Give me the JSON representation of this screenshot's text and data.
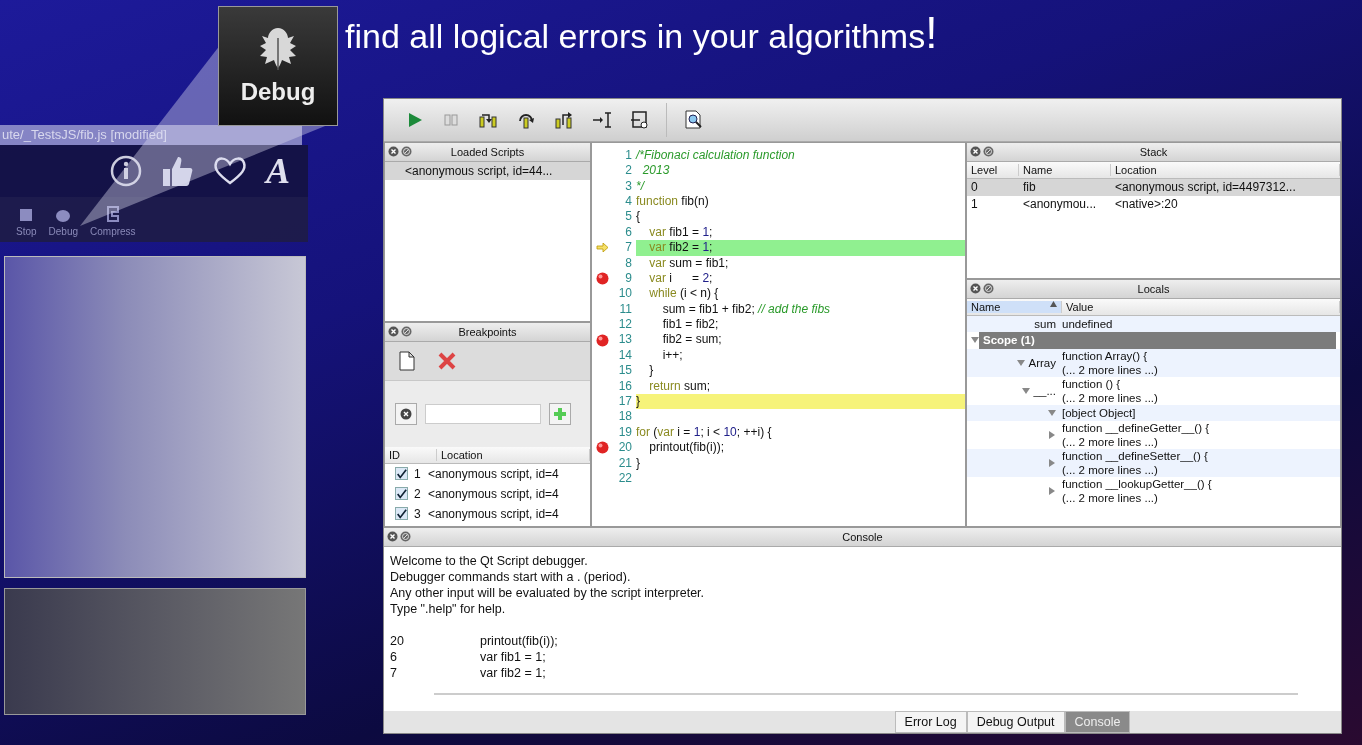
{
  "headline": {
    "text": "find all logical errors in your algorithms",
    "end": "!"
  },
  "callout": {
    "label": "Debug"
  },
  "background_app": {
    "title": "ute/_TestsJS/fib.js [modified]",
    "font_button": "A",
    "toolbar": [
      "Stop",
      "Debug",
      "Compress"
    ]
  },
  "loaded_scripts": {
    "title": "Loaded Scripts",
    "items": [
      {
        "text": "<anonymous script, id=44...",
        "selected": true
      }
    ]
  },
  "breakpoints": {
    "title": "Breakpoints",
    "columns": [
      "ID",
      "Location"
    ],
    "rows": [
      {
        "checked": true,
        "id": "1",
        "location": "<anonymous script, id=4"
      },
      {
        "checked": true,
        "id": "2",
        "location": "<anonymous script, id=4"
      },
      {
        "checked": true,
        "id": "3",
        "location": "<anonymous script, id=4"
      }
    ]
  },
  "code": {
    "lines": [
      {
        "number": "1",
        "breakpoint": false,
        "current": false,
        "highlighted": false,
        "tokens": [
          {
            "kind": "comment",
            "text": "/*Fibonaci calculation function"
          }
        ]
      },
      {
        "number": "2",
        "breakpoint": false,
        "current": false,
        "highlighted": false,
        "tokens": [
          {
            "kind": "comment",
            "text": "  2013"
          }
        ]
      },
      {
        "number": "3",
        "breakpoint": false,
        "current": false,
        "highlighted": false,
        "tokens": [
          {
            "kind": "comment",
            "text": "*/"
          }
        ]
      },
      {
        "number": "4",
        "breakpoint": false,
        "current": false,
        "highlighted": false,
        "tokens": [
          {
            "kind": "keyword",
            "text": "function"
          },
          {
            "kind": "plain",
            "text": " fib(n)"
          }
        ]
      },
      {
        "number": "5",
        "breakpoint": false,
        "current": false,
        "highlighted": false,
        "tokens": [
          {
            "kind": "plain",
            "text": "{"
          }
        ]
      },
      {
        "number": "6",
        "breakpoint": false,
        "current": false,
        "highlighted": false,
        "tokens": [
          {
            "kind": "keyword",
            "text": "    var"
          },
          {
            "kind": "plain",
            "text": " fib1 = "
          },
          {
            "kind": "number",
            "text": "1"
          },
          {
            "kind": "plain",
            "text": ";"
          }
        ]
      },
      {
        "number": "7",
        "breakpoint": false,
        "current": true,
        "highlighted": false,
        "tokens": [
          {
            "kind": "keyword",
            "text": "    var"
          },
          {
            "kind": "plain",
            "text": " fib2 = "
          },
          {
            "kind": "number",
            "text": "1"
          },
          {
            "kind": "plain",
            "text": ";"
          }
        ]
      },
      {
        "number": "8",
        "breakpoint": false,
        "current": false,
        "highlighted": false,
        "tokens": [
          {
            "kind": "keyword",
            "text": "    var"
          },
          {
            "kind": "plain",
            "text": " sum = fib1;"
          }
        ]
      },
      {
        "number": "9",
        "breakpoint": true,
        "current": false,
        "highlighted": false,
        "tokens": [
          {
            "kind": "keyword",
            "text": "    var"
          },
          {
            "kind": "plain",
            "text": " i      = "
          },
          {
            "kind": "number",
            "text": "2"
          },
          {
            "kind": "plain",
            "text": ";"
          }
        ]
      },
      {
        "number": "10",
        "breakpoint": false,
        "current": false,
        "highlighted": false,
        "tokens": [
          {
            "kind": "keyword",
            "text": "    while"
          },
          {
            "kind": "plain",
            "text": " (i < n) {"
          }
        ]
      },
      {
        "number": "11",
        "breakpoint": false,
        "current": false,
        "highlighted": false,
        "tokens": [
          {
            "kind": "plain",
            "text": "        sum = fib1 + fib2; "
          },
          {
            "kind": "comment",
            "text": "// add the fibs"
          }
        ]
      },
      {
        "number": "12",
        "breakpoint": false,
        "current": false,
        "highlighted": false,
        "tokens": [
          {
            "kind": "plain",
            "text": "        fib1 = fib2;"
          }
        ]
      },
      {
        "number": "13",
        "breakpoint": true,
        "current": false,
        "highlighted": false,
        "tokens": [
          {
            "kind": "plain",
            "text": "        fib2 = sum;"
          }
        ]
      },
      {
        "number": "14",
        "breakpoint": false,
        "current": false,
        "highlighted": false,
        "tokens": [
          {
            "kind": "plain",
            "text": "        i++;"
          }
        ]
      },
      {
        "number": "15",
        "breakpoint": false,
        "current": false,
        "highlighted": false,
        "tokens": [
          {
            "kind": "plain",
            "text": "    }"
          }
        ]
      },
      {
        "number": "16",
        "breakpoint": false,
        "current": false,
        "highlighted": false,
        "tokens": [
          {
            "kind": "keyword",
            "text": "    return"
          },
          {
            "kind": "plain",
            "text": " sum;"
          }
        ]
      },
      {
        "number": "17",
        "breakpoint": false,
        "current": false,
        "highlighted": true,
        "tokens": [
          {
            "kind": "plain",
            "text": "}"
          }
        ]
      },
      {
        "number": "18",
        "breakpoint": false,
        "current": false,
        "highlighted": false
      },
      {
        "number": "19",
        "breakpoint": false,
        "current": false,
        "highlighted": false,
        "tokens": [
          {
            "kind": "keyword",
            "text": "for"
          },
          {
            "kind": "plain",
            "text": " ("
          },
          {
            "kind": "keyword",
            "text": "var"
          },
          {
            "kind": "plain",
            "text": " i = "
          },
          {
            "kind": "number",
            "text": "1"
          },
          {
            "kind": "plain",
            "text": "; i < "
          },
          {
            "kind": "number",
            "text": "10"
          },
          {
            "kind": "plain",
            "text": "; ++i) {"
          }
        ]
      },
      {
        "number": "20",
        "breakpoint": true,
        "current": false,
        "highlighted": false,
        "tokens": [
          {
            "kind": "plain",
            "text": "    printout(fib(i));"
          }
        ]
      },
      {
        "number": "21",
        "breakpoint": false,
        "current": false,
        "highlighted": false,
        "tokens": [
          {
            "kind": "plain",
            "text": "}"
          }
        ]
      },
      {
        "number": "22",
        "breakpoint": false,
        "current": false,
        "highlighted": false
      }
    ]
  },
  "stack": {
    "title": "Stack",
    "columns": [
      "Level",
      "Name",
      "Location"
    ],
    "rows": [
      {
        "level": "0",
        "name": "fib",
        "location": "<anonymous script, id=4497312...",
        "selected": true
      },
      {
        "level": "1",
        "name": "<anonymou...",
        "location": "<native>:20",
        "selected": false
      }
    ]
  },
  "locals": {
    "title": "Locals",
    "columns": [
      "Name",
      "Value"
    ],
    "rows": [
      {
        "kind": "variable",
        "name": "sum",
        "value_lines": [
          "undefined"
        ]
      },
      {
        "kind": "group",
        "name": "Scope (1)",
        "expanded": true,
        "children": [
          {
            "kind": "variable",
            "name": "Array",
            "expanded": true,
            "value_lines": [
              "function Array() {",
              "(... 2 more lines ...)"
            ],
            "children": [
              {
                "kind": "variable",
                "name": "__...",
                "expanded": true,
                "value_lines": [
                  "function () {",
                  "(... 2 more lines ...)"
                ],
                "children": [
                  {
                    "kind": "variable",
                    "expanded": true,
                    "value_lines": [
                      "[object Object]"
                    ],
                    "children": [
                      {
                        "kind": "variable",
                        "expanded": false,
                        "value_lines": [
                          "function __defineGetter__() {",
                          "(... 2 more lines ...)"
                        ]
                      },
                      {
                        "kind": "variable",
                        "expanded": false,
                        "value_lines": [
                          "function __defineSetter__() {",
                          "(... 2 more lines ...)"
                        ]
                      },
                      {
                        "kind": "variable",
                        "expanded": false,
                        "value_lines": [
                          "function __lookupGetter__() {",
                          "(... 2 more lines ...)"
                        ]
                      }
                    ]
                  }
                ]
              }
            ]
          }
        ]
      }
    ]
  },
  "console": {
    "title": "Console",
    "messages": [
      "Welcome to the Qt Script debugger.",
      "Debugger commands start with a . (period).",
      "Any other input will be evaluated by the script interpreter.",
      "Type \".help\" for help."
    ],
    "trace": [
      {
        "line": "20",
        "code": "printout(fib(i));"
      },
      {
        "line": "6",
        "code": "var fib1 = 1;"
      },
      {
        "line": "7",
        "code": "var fib2 = 1;"
      }
    ],
    "tabs": [
      {
        "label": "Error Log",
        "selected": false
      },
      {
        "label": "Debug Output",
        "selected": false
      },
      {
        "label": "Console",
        "selected": true
      }
    ]
  }
}
